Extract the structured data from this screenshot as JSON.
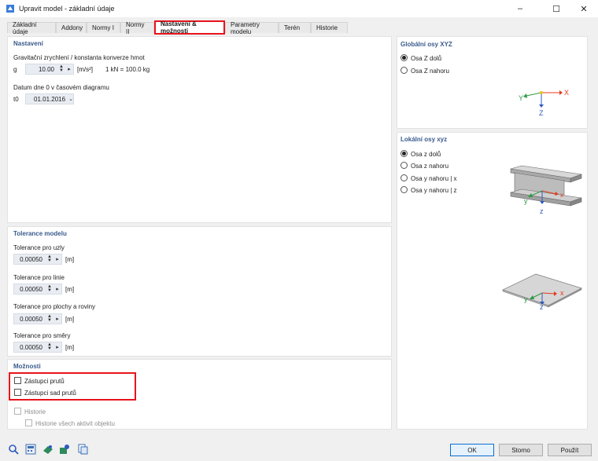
{
  "window": {
    "title": "Upravit model - základní údaje",
    "minimize": "–",
    "maximize": "☐",
    "close": "✕"
  },
  "tabs": [
    {
      "label": "Základní údaje"
    },
    {
      "label": "Addony"
    },
    {
      "label": "Normy I"
    },
    {
      "label": "Normy II"
    },
    {
      "label": "Nastavení & možnosti"
    },
    {
      "label": "Parametry modelu"
    },
    {
      "label": "Terén"
    },
    {
      "label": "Historie"
    }
  ],
  "settings": {
    "title": "Nastavení",
    "gravity_label": "Gravitační zrychlení / konstanta konverze hmot",
    "g_symbol": "g",
    "g_value": "10.00",
    "g_unit": "[m/s²]",
    "conversion": "1 kN = 100.0 kg",
    "date_label": "Datum dne 0 v časovém diagramu",
    "date_symbol": "t0",
    "date_value": "01.01.2016"
  },
  "tolerance": {
    "title": "Tolerance modelu",
    "items": [
      {
        "label": "Tolerance pro uzly",
        "value": "0.00050",
        "unit": "[m]"
      },
      {
        "label": "Tolerance pro linie",
        "value": "0.00050",
        "unit": "[m]"
      },
      {
        "label": "Tolerance pro plochy a roviny",
        "value": "0.00050",
        "unit": "[m]"
      },
      {
        "label": "Tolerance pro směry",
        "value": "0.00050",
        "unit": "[m]"
      }
    ]
  },
  "options": {
    "title": "Možnosti",
    "member_reps": "Zástupci prutů",
    "member_set_reps": "Zástupci sad prutů",
    "history": "Historie",
    "history_all": "Historie všech aktivit objektu"
  },
  "global_axes": {
    "title": "Globální osy XYZ",
    "options": [
      "Osa Z dolů",
      "Osa Z nahoru"
    ],
    "selected": 0,
    "axis_x": "X",
    "axis_y": "Y",
    "axis_z": "Z"
  },
  "local_axes": {
    "title": "Lokální osy xyz",
    "options": [
      "Osa z dolů",
      "Osa z nahoru",
      "Osa y nahoru | x",
      "Osa y nahoru | z"
    ],
    "selected": 0,
    "axis_x": "x",
    "axis_y": "y",
    "axis_z": "z"
  },
  "footer": {
    "ok": "OK",
    "cancel": "Storno",
    "apply": "Použít"
  },
  "icons": [
    "search-icon",
    "calculator-icon",
    "model-icon",
    "settings-icon",
    "copy-icon"
  ],
  "colors": {
    "highlight": "#e8141c",
    "x_axis": "#e8381c",
    "y_axis": "#2e9a44",
    "z_axis": "#2d5bbf"
  }
}
